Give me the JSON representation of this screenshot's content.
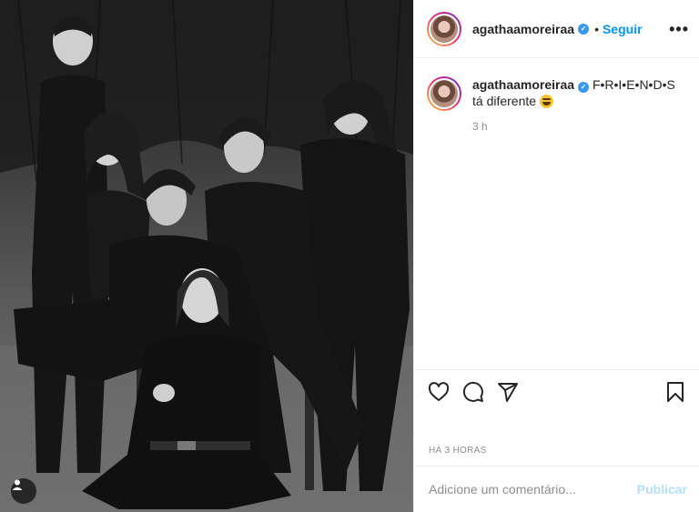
{
  "post": {
    "username": "agathaamoreiraa",
    "verified_icon": "verified-badge-icon",
    "follow_label": "Seguir",
    "more_icon": "more-options-icon",
    "caption_text": "F•R•I•E•N•D•S tá diferente",
    "caption_emoji": "grinning-sweat-emoji",
    "time_ago": "3 h",
    "date_label": "HÁ 3 HORAS",
    "comment_placeholder": "Adicione um comentário...",
    "publish_label": "Publicar",
    "photo_alt": "Foto em preto e branco de seis pessoas posando juntas em um jardim"
  },
  "icons": {
    "like": "heart-icon",
    "comment": "comment-icon",
    "share": "share-icon",
    "save": "bookmark-icon",
    "user_tag": "user-tag-icon"
  },
  "colors": {
    "brand_blue": "#0095f6",
    "publish_disabled": "#b2dffc",
    "text": "#262626",
    "secondary": "#8e8e8e",
    "divider": "#efefef"
  }
}
